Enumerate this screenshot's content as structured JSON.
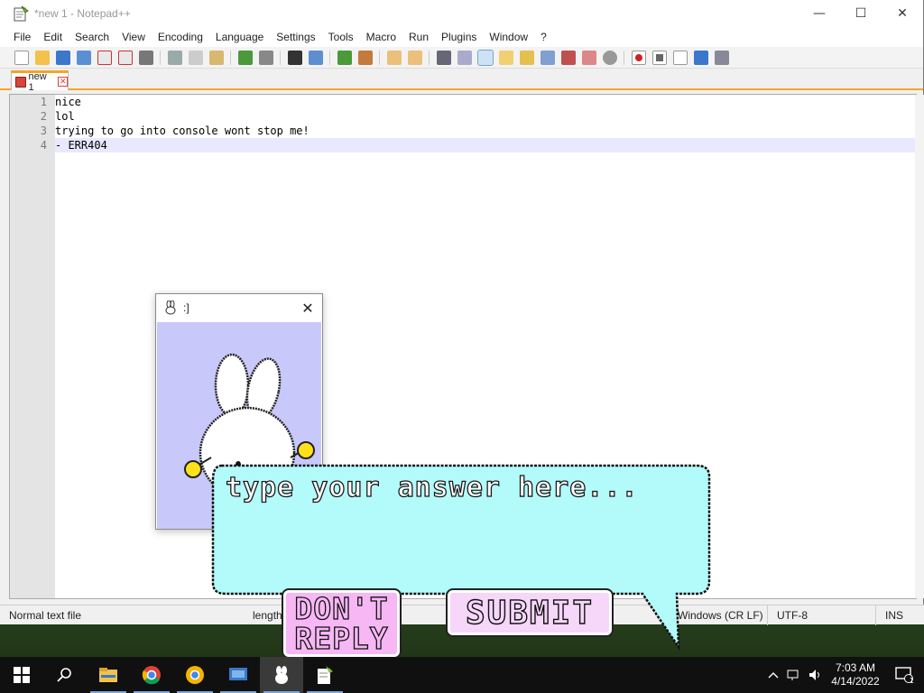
{
  "window": {
    "title": "*new 1 - Notepad++",
    "controls": {
      "minimize": "—",
      "maximize": "☐",
      "close": "✕"
    }
  },
  "menu": [
    "File",
    "Edit",
    "Search",
    "View",
    "Encoding",
    "Language",
    "Settings",
    "Tools",
    "Macro",
    "Run",
    "Plugins",
    "Window",
    "?"
  ],
  "tab": {
    "label": "new 1",
    "close": "✕"
  },
  "editor": {
    "lines": [
      "nice",
      "lol",
      "trying to go into console wont stop me!",
      "- ERR404"
    ],
    "line_numbers": [
      "1",
      "2",
      "3",
      "4"
    ]
  },
  "status": {
    "filetype": "Normal text file",
    "length": "length",
    "eol": "Windows (CR LF)",
    "encoding": "UTF-8",
    "mode": "INS"
  },
  "popup": {
    "title": ":]",
    "close": "✕"
  },
  "prompt": {
    "placeholder": "type your answer here...",
    "dont_reply_line1": "DON'T",
    "dont_reply_line2": "REPLY",
    "submit": "SUBMIT"
  },
  "taskbar": {
    "time": "7:03 AM",
    "date": "4/14/2022",
    "notification_count": "1"
  },
  "colors": {
    "bubble": "#b3fbfb",
    "popup_bg": "#c9c8fb",
    "button_pink": "#f6b7f4",
    "button_light_pink": "#f6d7fa",
    "tab_accent": "#f5a623"
  }
}
